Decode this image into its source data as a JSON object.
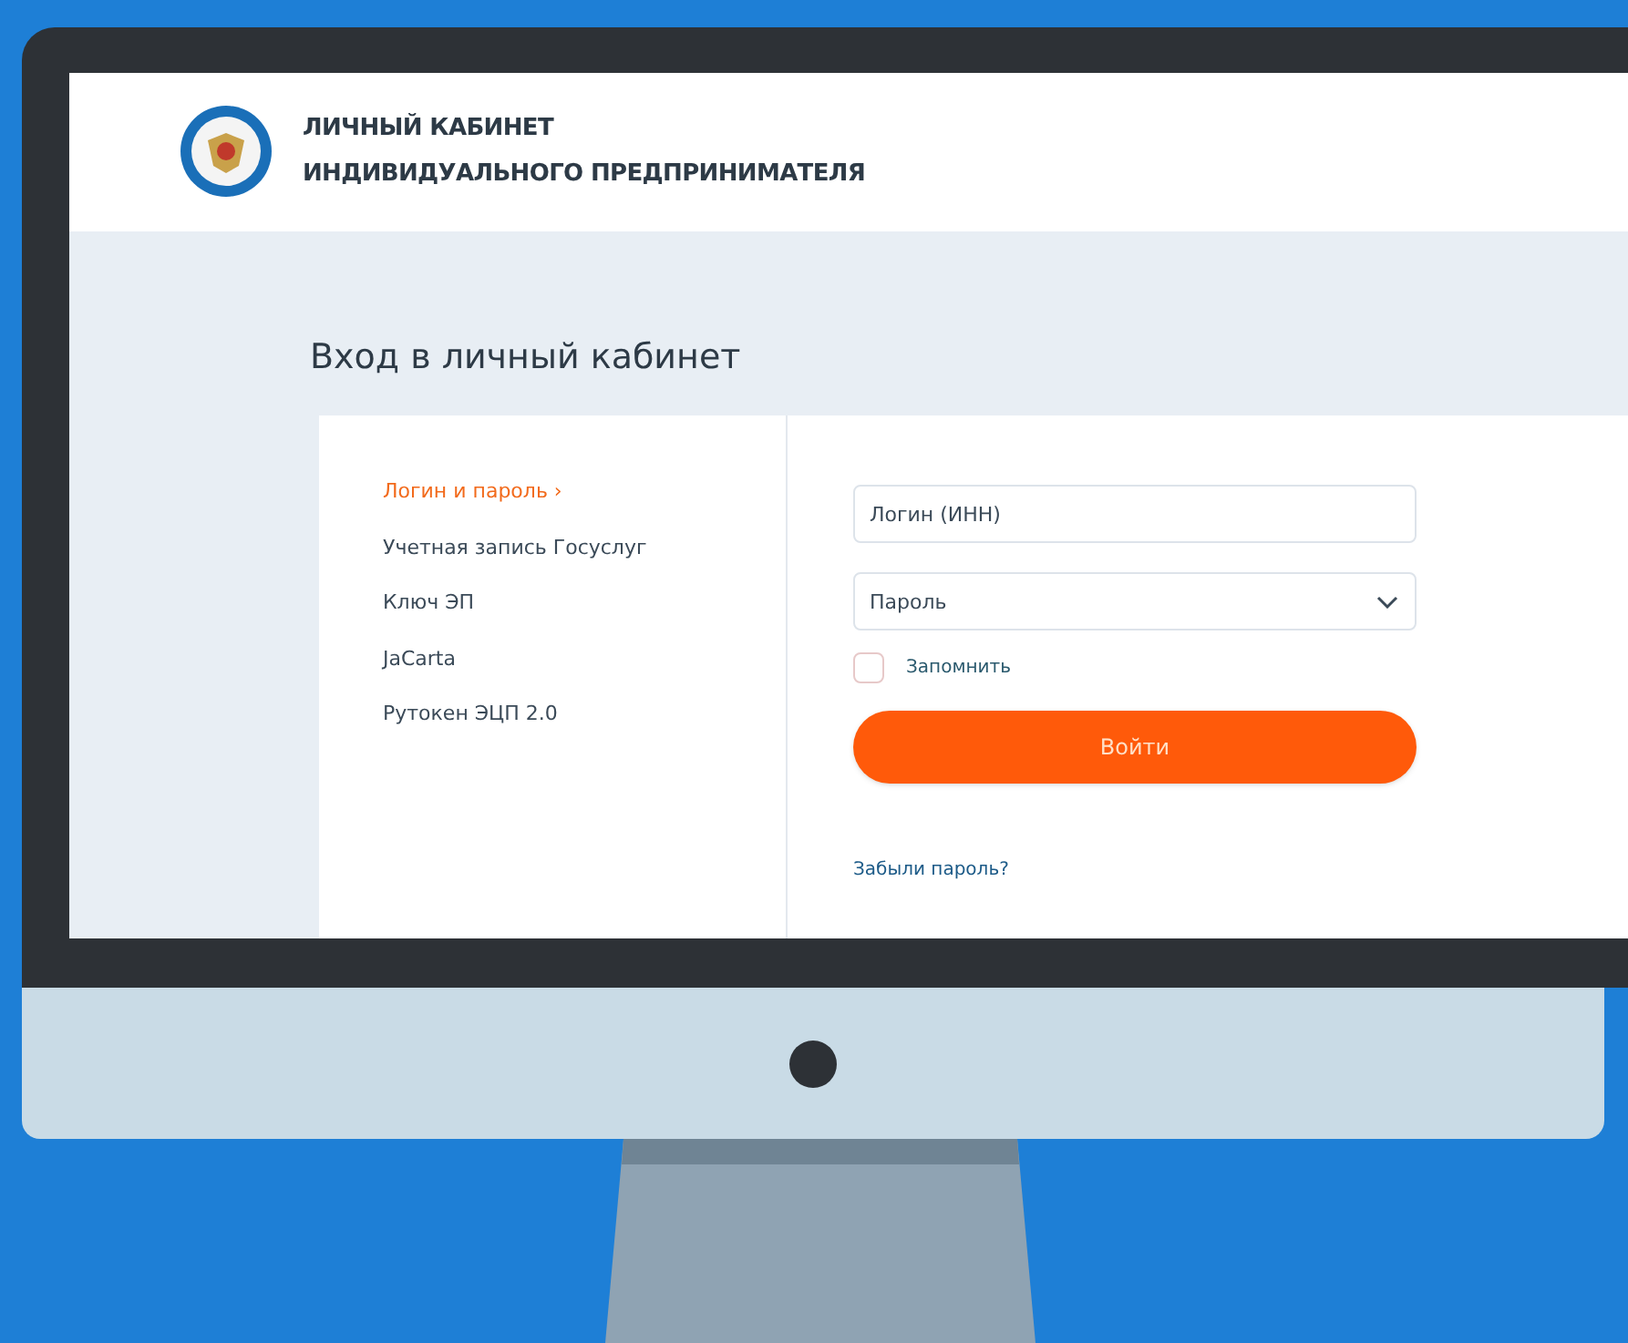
{
  "header": {
    "title_line_1": "ЛИЧНЫЙ КАБИНЕТ",
    "title_line_2": "ИНДИВИДУАЛЬНОГО ПРЕДПРИНИМАТЕЛЯ"
  },
  "page_title": "Вход в личный кабинет",
  "login_methods": [
    {
      "label": "Логин и пароль",
      "arrow": "›",
      "selected": true
    },
    {
      "label": "Учетная запись Госуслуг",
      "selected": false
    },
    {
      "label": "Ключ ЭП",
      "selected": false
    },
    {
      "label": "JaCarta",
      "selected": false
    },
    {
      "label": "Рутокен ЭЦП 2.0",
      "selected": false
    }
  ],
  "form": {
    "login": {
      "placeholder": "Логин (ИНН)"
    },
    "password": {
      "placeholder": "Пароль"
    },
    "remember": {
      "label": "Запомнить",
      "checked": false
    },
    "submit": "Войти",
    "forgot_link": "Забыли пароль?"
  }
}
